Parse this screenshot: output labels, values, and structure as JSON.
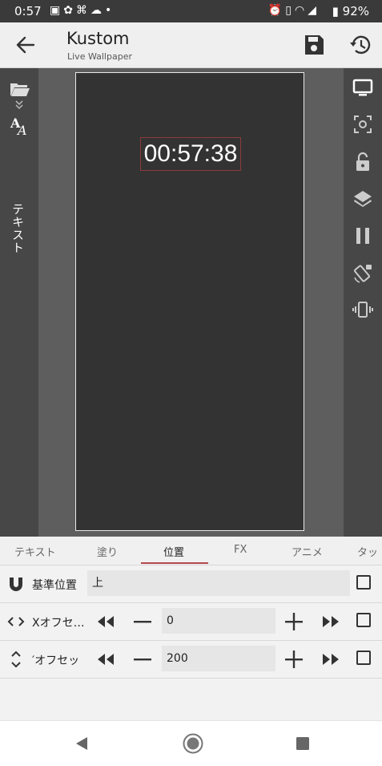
{
  "status_bar": {
    "time": "0:57",
    "battery": "92%",
    "left_icons": [
      "image-icon",
      "google-photos-icon",
      "launcher-icon",
      "cloud-upload-icon",
      "dot-icon"
    ],
    "right_icons": [
      "alarm-icon",
      "vibrate-icon",
      "wifi-icon",
      "signal-icon",
      "battery-icon"
    ]
  },
  "app_bar": {
    "title": "Kustom",
    "subtitle": "Live Wallpaper"
  },
  "preview": {
    "clock_text": "00:57:38"
  },
  "left_rail": {
    "layer_name": "テキスト"
  },
  "tabs": [
    {
      "label": "テキスト"
    },
    {
      "label": "塗り"
    },
    {
      "label": "位置",
      "selected": true
    },
    {
      "label": "FX"
    },
    {
      "label": "アニメ"
    },
    {
      "label": "タッ"
    }
  ],
  "properties": {
    "anchor": {
      "label": "基準位置",
      "value": "上"
    },
    "x_offset": {
      "label": "Xオフセ…",
      "value": "0"
    },
    "y_offset": {
      "label": "′オフセッ",
      "value": "200"
    }
  },
  "colors": {
    "accent": "#b4474f",
    "toolbar_bg": "#efefef",
    "canvas_bg": "#333333"
  }
}
